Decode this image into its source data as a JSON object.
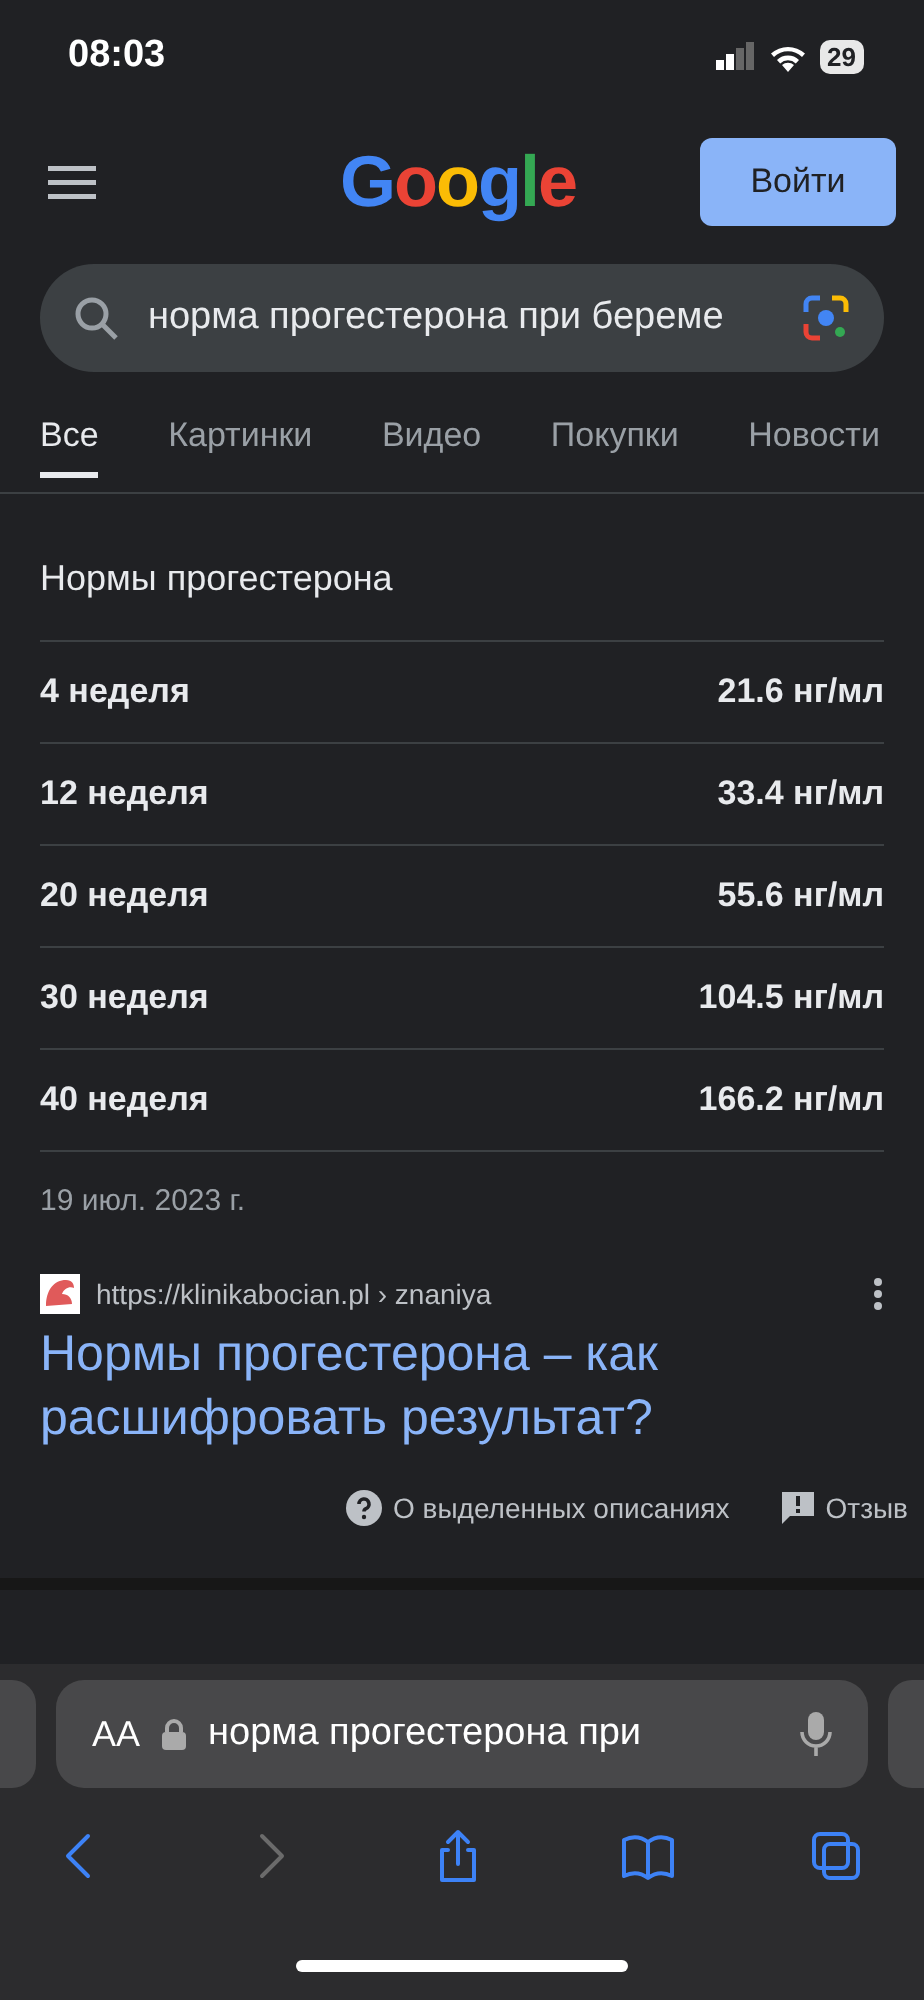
{
  "status_bar": {
    "time": "08:03",
    "battery": "29"
  },
  "header": {
    "logo": "Google",
    "sign_in": "Войти"
  },
  "search": {
    "value": "норма прогестерона при береме"
  },
  "tabs": [
    {
      "label": "Все",
      "selected": true
    },
    {
      "label": "Картинки",
      "selected": false
    },
    {
      "label": "Видео",
      "selected": false
    },
    {
      "label": "Покупки",
      "selected": false
    },
    {
      "label": "Новости",
      "selected": false
    }
  ],
  "snippet": {
    "title": "Нормы прогестерона",
    "rows": [
      {
        "label": "4 неделя",
        "value": "21.6 нг/мл"
      },
      {
        "label": "12 неделя",
        "value": "33.4 нг/мл"
      },
      {
        "label": "20 неделя",
        "value": "55.6 нг/мл"
      },
      {
        "label": "30 неделя",
        "value": "104.5 нг/мл"
      },
      {
        "label": "40 неделя",
        "value": "166.2 нг/мл"
      }
    ],
    "date": "19 июл. 2023 г.",
    "url": "https://klinikabocian.pl",
    "path": "› znaniya",
    "result_title": "Нормы прогестерона – как расшифровать результат?",
    "about": "О выделенных описаниях",
    "feedback": "Отзыв"
  },
  "browser": {
    "text_size": "AA",
    "address": "норма прогестерона при",
    "nav": [
      {
        "kind": "back",
        "disabled": false
      },
      {
        "kind": "forward",
        "disabled": true
      },
      {
        "kind": "share",
        "disabled": false
      },
      {
        "kind": "bookmarks",
        "disabled": false
      },
      {
        "kind": "tabs",
        "disabled": false
      }
    ]
  }
}
